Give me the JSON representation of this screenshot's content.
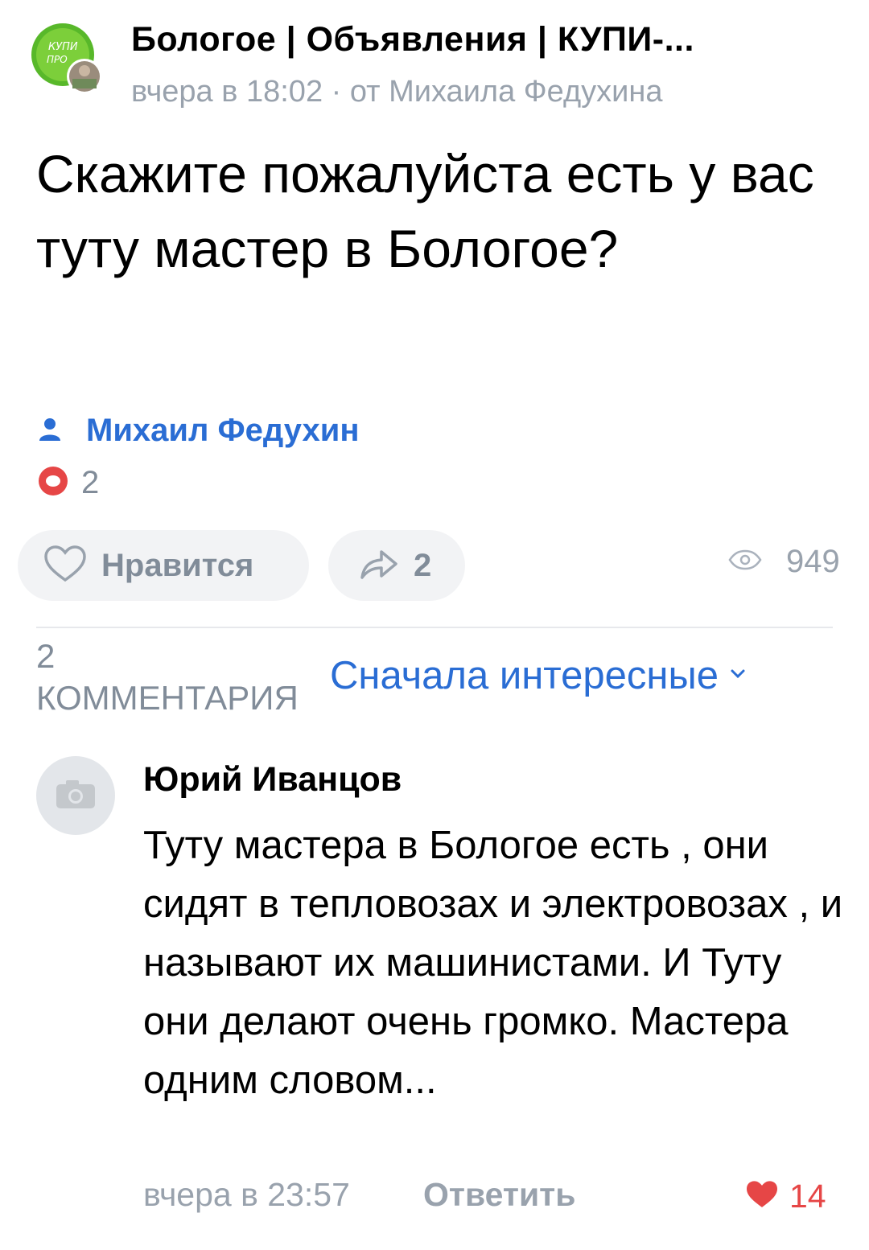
{
  "post": {
    "group_title": "Бологое | Объявления | КУПИ-...",
    "group_logo_text": "КУПИ ПРО",
    "meta": "вчера в 18:02 · от Михаила Федухина",
    "text": "Скажите пожалуйста есть у вас туту мастер в Бологое?",
    "author": "Михаил Федухин",
    "comments_badge": "2",
    "like_label": "Нравится",
    "shares": "2",
    "views": "949"
  },
  "comments_section": {
    "heading": "2 КОММЕНТАРИЯ",
    "sort_label": "Сначала интересные"
  },
  "comment": {
    "author": "Юрий Иванцов",
    "text": "Туту мастера в Бологое есть , они сидят в тепловозах и электровозах , и называют их машинистами. И Туту они делают очень громко. Мастера одним словом...",
    "time": "вчера в 23:57",
    "reply_label": "Ответить",
    "likes": "14"
  },
  "colors": {
    "accent": "#2a6dd4",
    "muted": "#818c99",
    "like_red": "#e64646",
    "logo_green": "#4caf24"
  },
  "icons": [
    "group-avatar",
    "person-icon",
    "comment-bubble-icon",
    "heart-outline-icon",
    "share-arrow-icon",
    "eye-icon",
    "chevron-down-icon",
    "camera-icon",
    "heart-filled-icon"
  ]
}
